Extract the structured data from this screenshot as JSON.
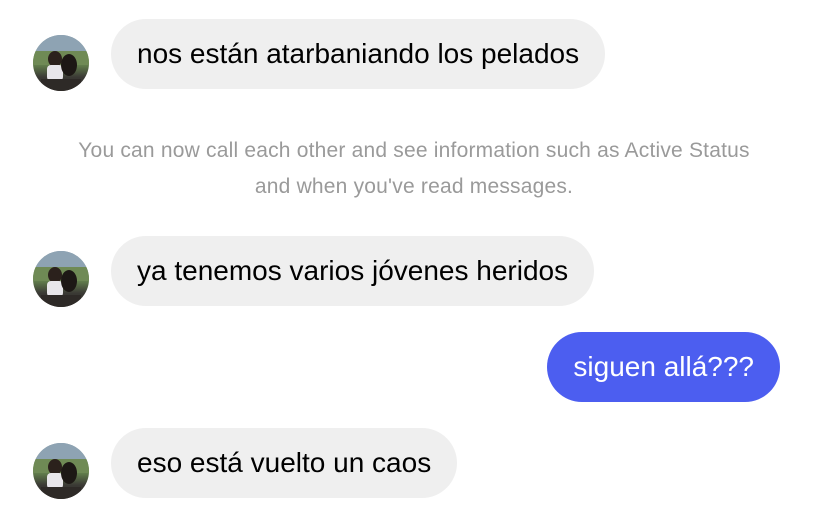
{
  "conversation": {
    "messages": [
      {
        "direction": "incoming",
        "text": "nos están atarbaniando los pelados",
        "avatar": "contact-avatar"
      },
      {
        "direction": "incoming",
        "text": "ya tenemos varios jóvenes heridos",
        "avatar": "contact-avatar"
      },
      {
        "direction": "outgoing",
        "text": "siguen allá???"
      },
      {
        "direction": "incoming",
        "text": "eso está vuelto un caos",
        "avatar": "contact-avatar"
      }
    ],
    "notice": {
      "line1": "You can now call each other and see information such as Active Status",
      "line2": "and when you've read messages."
    }
  },
  "colors": {
    "incoming_bubble": "#efefef",
    "outgoing_bubble": "#4c5ef0",
    "notice_text": "#9a9a9a"
  }
}
